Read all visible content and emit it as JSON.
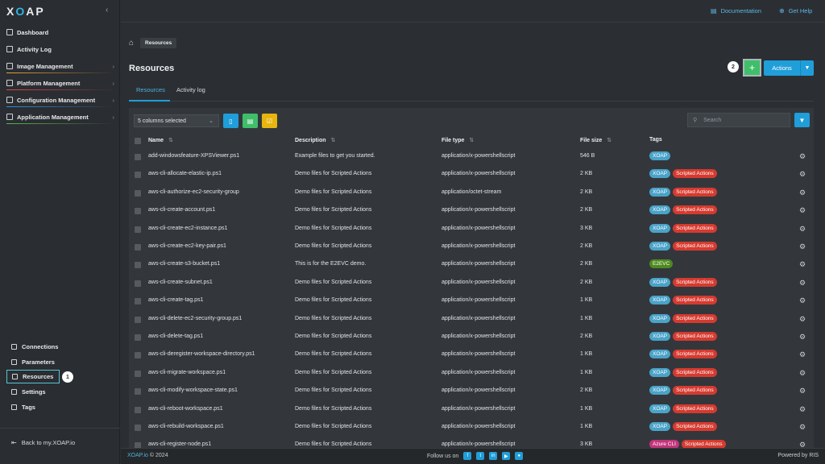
{
  "app": {
    "logo": "XOAP"
  },
  "sidebar": {
    "nav": [
      {
        "label": "Dashboard",
        "icon": "dashboard-icon",
        "chev": false,
        "line": ""
      },
      {
        "label": "Activity Log",
        "icon": "clock-icon",
        "chev": false,
        "line": ""
      },
      {
        "label": "Image Management",
        "icon": "image-icon",
        "chev": true,
        "line": "#e8a23a"
      },
      {
        "label": "Platform Management",
        "icon": "platform-icon",
        "chev": true,
        "line": "#e04848"
      },
      {
        "label": "Configuration Management",
        "icon": "config-icon",
        "chev": true,
        "line": "#2f8fe0"
      },
      {
        "label": "Application Management",
        "icon": "app-icon",
        "chev": true,
        "line": "#53b84b"
      }
    ],
    "secondary": [
      {
        "label": "Connections",
        "icon": "link-icon"
      },
      {
        "label": "Parameters",
        "icon": "list-icon"
      },
      {
        "label": "Resources",
        "icon": "box-icon",
        "active": true
      },
      {
        "label": "Settings",
        "icon": "gear-icon"
      },
      {
        "label": "Tags",
        "icon": "bookmark-icon"
      }
    ],
    "step_badge": "1",
    "back_label": "Back to my.XOAP.io"
  },
  "topbar": {
    "documentation": "Documentation",
    "help": "Get Help"
  },
  "breadcrumb": {
    "current": "Resources"
  },
  "page": {
    "title": "Resources",
    "step_badge": "2",
    "add_label": "+",
    "actions_label": "Actions"
  },
  "tabs": [
    {
      "label": "Resources",
      "active": true
    },
    {
      "label": "Activity log",
      "active": false
    }
  ],
  "toolbar": {
    "column_select": "5 columns selected",
    "search_placeholder": "Search"
  },
  "table": {
    "columns": [
      "Name",
      "Description",
      "File type",
      "File size",
      "Tags"
    ],
    "rows": [
      {
        "name": "add-windowsfeature-XPSViewer.ps1",
        "desc": "Example files to get you started.",
        "type": "application/x-powershellscript",
        "size": "546 B",
        "tags": [
          "XOAP"
        ]
      },
      {
        "name": "aws-cli-allocate-elastic-ip.ps1",
        "desc": "Demo files for Scripted Actions",
        "type": "application/x-powershellscript",
        "size": "2 KB",
        "tags": [
          "XOAP",
          "Scripted Actions"
        ]
      },
      {
        "name": "aws-cli-authorize-ec2-security-group",
        "desc": "Demo files for Scripted Actions",
        "type": "application/octet-stream",
        "size": "2 KB",
        "tags": [
          "XOAP",
          "Scripted Actions"
        ]
      },
      {
        "name": "aws-cli-create-account.ps1",
        "desc": "Demo files for Scripted Actions",
        "type": "application/x-powershellscript",
        "size": "2 KB",
        "tags": [
          "XOAP",
          "Scripted Actions"
        ]
      },
      {
        "name": "aws-cli-create-ec2-instance.ps1",
        "desc": "Demo files for Scripted Actions",
        "type": "application/x-powershellscript",
        "size": "3 KB",
        "tags": [
          "XOAP",
          "Scripted Actions"
        ]
      },
      {
        "name": "aws-cli-create-ec2-key-pair.ps1",
        "desc": "Demo files for Scripted Actions",
        "type": "application/x-powershellscript",
        "size": "2 KB",
        "tags": [
          "XOAP",
          "Scripted Actions"
        ]
      },
      {
        "name": "aws-cli-create-s3-bucket.ps1",
        "desc": "This is for the E2EVC demo.",
        "type": "application/x-powershellscript",
        "size": "2 KB",
        "tags": [
          "E2EVC"
        ]
      },
      {
        "name": "aws-cli-create-subnet.ps1",
        "desc": "Demo files for Scripted Actions",
        "type": "application/x-powershellscript",
        "size": "2 KB",
        "tags": [
          "XOAP",
          "Scripted Actions"
        ]
      },
      {
        "name": "aws-cli-create-tag.ps1",
        "desc": "Demo files for Scripted Actions",
        "type": "application/x-powershellscript",
        "size": "1 KB",
        "tags": [
          "XOAP",
          "Scripted Actions"
        ]
      },
      {
        "name": "aws-cli-delete-ec2-security-group.ps1",
        "desc": "Demo files for Scripted Actions",
        "type": "application/x-powershellscript",
        "size": "1 KB",
        "tags": [
          "XOAP",
          "Scripted Actions"
        ]
      },
      {
        "name": "aws-cli-delete-tag.ps1",
        "desc": "Demo files for Scripted Actions",
        "type": "application/x-powershellscript",
        "size": "2 KB",
        "tags": [
          "XOAP",
          "Scripted Actions"
        ]
      },
      {
        "name": "aws-cli-deregister-workspace-directory.ps1",
        "desc": "Demo files for Scripted Actions",
        "type": "application/x-powershellscript",
        "size": "1 KB",
        "tags": [
          "XOAP",
          "Scripted Actions"
        ]
      },
      {
        "name": "aws-cli-migrate-workspace.ps1",
        "desc": "Demo files for Scripted Actions",
        "type": "application/x-powershellscript",
        "size": "1 KB",
        "tags": [
          "XOAP",
          "Scripted Actions"
        ]
      },
      {
        "name": "aws-cli-modify-workspace-state.ps1",
        "desc": "Demo files for Scripted Actions",
        "type": "application/x-powershellscript",
        "size": "2 KB",
        "tags": [
          "XOAP",
          "Scripted Actions"
        ]
      },
      {
        "name": "aws-cli-reboot-workspace.ps1",
        "desc": "Demo files for Scripted Actions",
        "type": "application/x-powershellscript",
        "size": "1 KB",
        "tags": [
          "XOAP",
          "Scripted Actions"
        ]
      },
      {
        "name": "aws-cli-rebuild-workspace.ps1",
        "desc": "Demo files for Scripted Actions",
        "type": "application/x-powershellscript",
        "size": "1 KB",
        "tags": [
          "XOAP",
          "Scripted Actions"
        ]
      },
      {
        "name": "aws-cli-register-node.ps1",
        "desc": "Demo files for Scripted Actions",
        "type": "application/x-powershellscript",
        "size": "3 KB",
        "tags": [
          "Azure CLI",
          "Scripted Actions"
        ]
      }
    ]
  },
  "tag_colors": {
    "XOAP": "#4aa3c8",
    "Scripted Actions": "#d63a2f",
    "E2EVC": "#4e8a1f",
    "Azure CLI": "#c2357a"
  },
  "footer": {
    "brand": "XOAP.io",
    "copyright": "© 2024",
    "follow": "Follow us on",
    "powered": "Powered by RIS"
  }
}
